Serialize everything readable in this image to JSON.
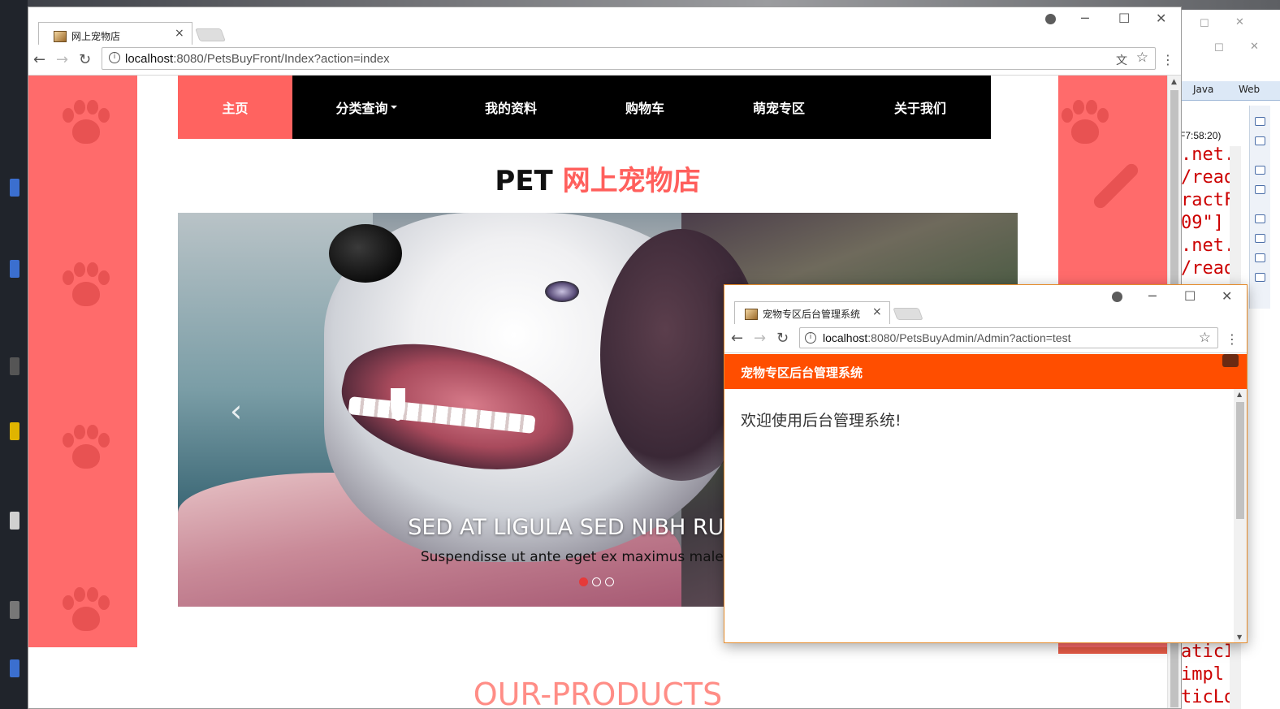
{
  "main_browser": {
    "tab_title": "网上宠物店",
    "tab_close": "×",
    "url_host": "localhost",
    "url_rest": ":8080/PetsBuyFront/Index?action=index",
    "window_controls": {
      "minimize": "─",
      "maximize": "☐",
      "close": "✕"
    },
    "nav_buttons": {
      "back": "←",
      "forward": "→",
      "reload": "↻"
    },
    "menu": "⋮",
    "star": "☆",
    "translate": "文"
  },
  "site": {
    "nav": [
      {
        "label": "主页",
        "active": true
      },
      {
        "label": "分类查询",
        "dropdown": true
      },
      {
        "label": "我的资料"
      },
      {
        "label": "购物车"
      },
      {
        "label": "萌宠专区"
      },
      {
        "label": "关于我们"
      }
    ],
    "title_prefix": "PET",
    "title_accent": "网上宠物店",
    "carousel": {
      "prev": "‹",
      "caption_title": "SED AT LIGULA SED NIBH RUTRUM",
      "caption_text": "Suspendisse ut ante eget ex maximus malesuada t",
      "slides": 3,
      "active_slide": 1
    },
    "products_heading": "OUR-PRODUCTS",
    "accent_color": "#ff6360",
    "band_color": "#ff6b6b"
  },
  "admin_browser": {
    "tab_title": "宠物专区后台管理系统",
    "tab_close": "×",
    "url_host": "localhost",
    "url_rest": ":8080/PetsBuyAdmin/Admin?action=test",
    "window_controls": {
      "minimize": "─",
      "maximize": "☐",
      "close": "✕"
    },
    "header_title": "宠物专区后台管理系统",
    "welcome": "欢迎使用后台管理系统!",
    "header_color": "#ff4e00"
  },
  "ide": {
    "tabs": [
      "Java",
      "Web"
    ],
    "time": "F7:58:20)",
    "code_lines": [
      ".net.",
      "/read",
      "ractF",
      "09\"]",
      ".net.",
      "/read",
      "aticI",
      " impl",
      "ticLo"
    ]
  }
}
